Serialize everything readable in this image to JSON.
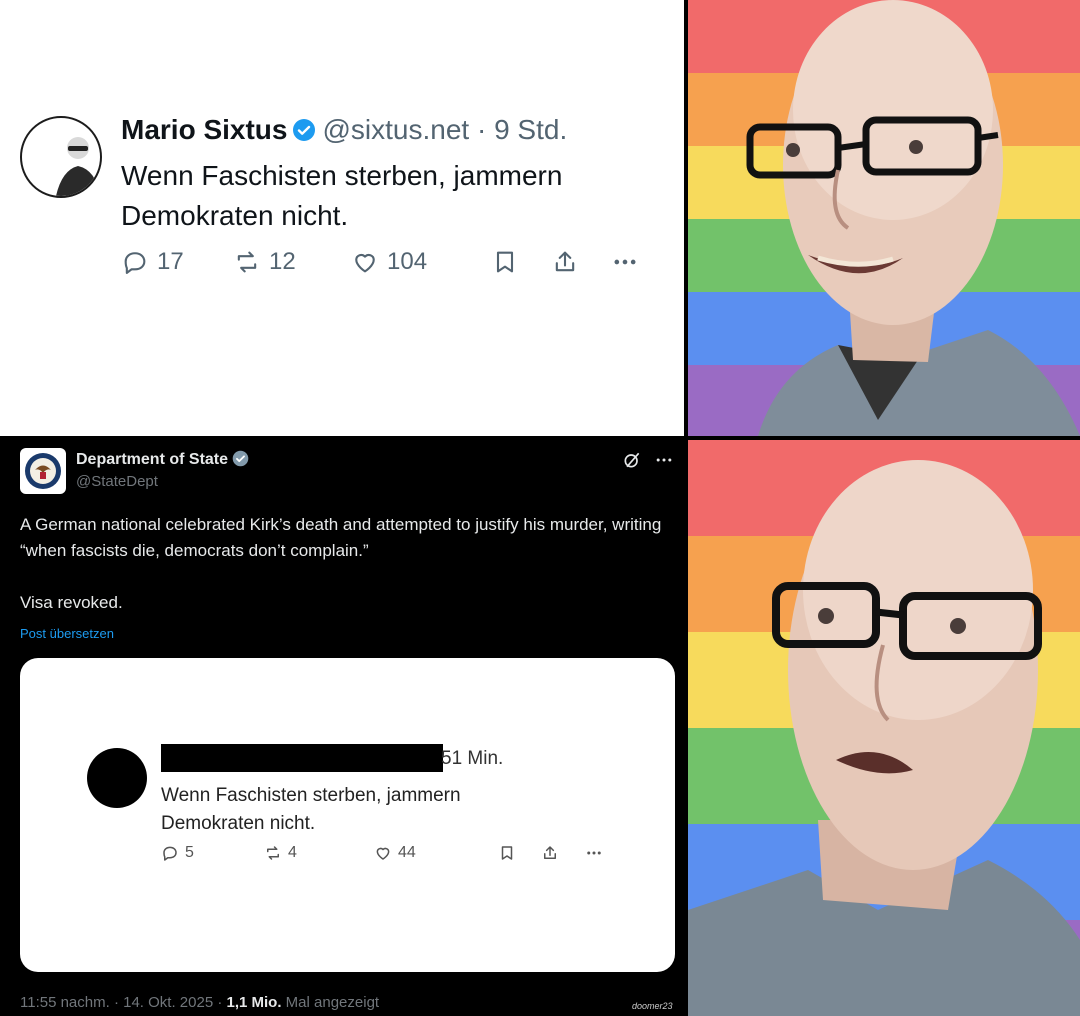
{
  "top_tweet": {
    "name": "Mario Sixtus",
    "handle_time": "@sixtus.net · 9 Std.",
    "text": "Wenn Faschisten sterben, jammern Demokraten nicht.",
    "replies": "17",
    "reposts": "12",
    "likes": "104"
  },
  "bottom_tweet": {
    "name": "Department of State",
    "handle": "@StateDept",
    "body_line1": "A German national celebrated Kirk’s death and attempted to justify his murder, writing “when fascists die, democrats don’t complain.”",
    "body_line2": "Visa revoked.",
    "translate": "Post übersetzen",
    "quoted": {
      "time": "51 Min.",
      "text": "Wenn Faschisten sterben, jammern Demokraten nicht.",
      "replies": "5",
      "reposts": "4",
      "likes": "44"
    },
    "footer_time": "11:55 nachm. · 14. Okt. 2025 · ",
    "footer_views": "1,1 Mio.",
    "footer_suffix": " Mal angezeigt",
    "signature": "doomer23"
  },
  "colors": {
    "rainbow": [
      "#f16a6a",
      "#f6a14f",
      "#f7da5c",
      "#72c26a",
      "#5b8ff0",
      "#9a6bc4"
    ],
    "verified": "#1d9bf0",
    "dark_bg": "#000000"
  }
}
